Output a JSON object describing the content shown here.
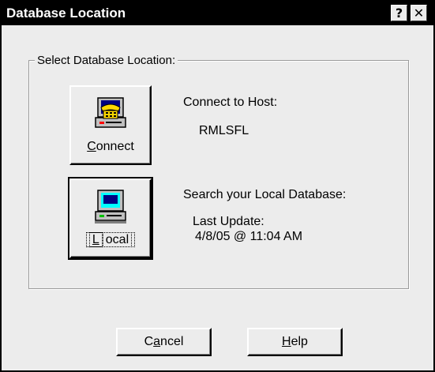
{
  "window": {
    "title": "Database Location",
    "help_glyph": "?",
    "close_glyph": "✕"
  },
  "group": {
    "label": "Select Database Location:"
  },
  "connect": {
    "button_label_first": "C",
    "button_label_rest": "onnect",
    "heading": "Connect to Host:",
    "host": "RMLSFL",
    "icon": "phone-computer-icon"
  },
  "local": {
    "button_label_first": "L",
    "button_label_rest": "ocal",
    "heading": "Search your Local Database:",
    "update_label": "Last Update:",
    "update_value": "4/8/05 @ 11:04 AM",
    "icon": "computer-icon"
  },
  "buttons": {
    "cancel_pre": "C",
    "cancel_u": "a",
    "cancel_post": "ncel",
    "help_u": "H",
    "help_post": "elp"
  }
}
